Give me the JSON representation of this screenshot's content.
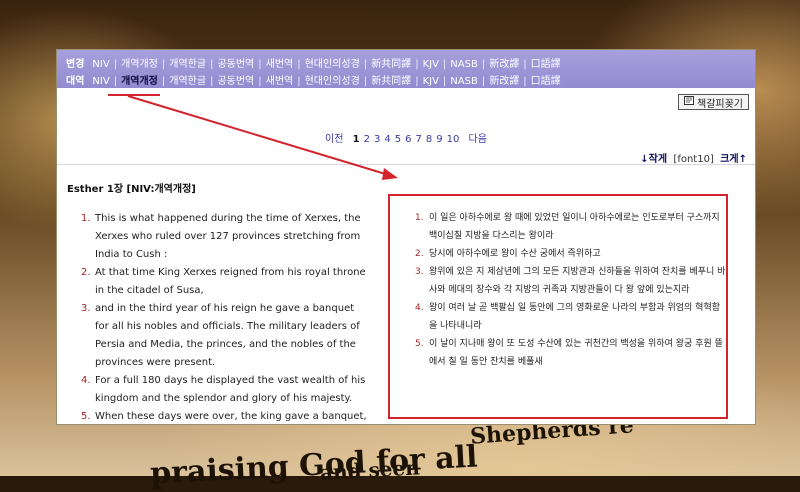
{
  "background": {
    "lines": [
      "praising God for all",
      "Shepherds re",
      "and seen"
    ]
  },
  "menu": {
    "row1": {
      "label": "변경",
      "items": [
        "NIV",
        "개역개정",
        "개역한글",
        "공동번역",
        "새번역",
        "현대인의성경",
        "新共同譯",
        "KJV",
        "NASB",
        "新改譯",
        "口語譯"
      ],
      "active_index": -1
    },
    "row2": {
      "label": "대역",
      "items": [
        "NIV",
        "개역개정",
        "개역한글",
        "공동번역",
        "새번역",
        "현대인의성경",
        "新共同譯",
        "KJV",
        "NASB",
        "新改譯",
        "口語譯"
      ],
      "active_index": 1
    }
  },
  "toolbar": {
    "bookmark_label": "책갈피꽂기"
  },
  "pager": {
    "prev": "이전",
    "pages": [
      "1",
      "2",
      "3",
      "4",
      "5",
      "6",
      "7",
      "8",
      "9",
      "10"
    ],
    "current": "1",
    "next": "다음"
  },
  "font_control": {
    "smaller": "↓작게",
    "current": "[font10]",
    "bigger": "크게↑"
  },
  "chapter_title": "Esther 1장 [NIV:개역개정]",
  "verses_en": [
    {
      "num": "1.",
      "text": "This is what happened during the time of Xerxes, the Xerxes who ruled over 127 provinces stretching from India to Cush :"
    },
    {
      "num": "2.",
      "text": "At that time King Xerxes reigned from his royal throne in the citadel of Susa,"
    },
    {
      "num": "3.",
      "text": "and in the third year of his reign he gave a banquet for all his nobles and officials. The military leaders of Persia and Media, the princes, and the nobles of the provinces were present."
    },
    {
      "num": "4.",
      "text": "For a full 180 days he displayed the vast wealth of his kingdom and the splendor and glory of his majesty."
    },
    {
      "num": "5.",
      "text": "When these days were over, the king gave a banquet, lasting seven days, in the enclosed garden of the king's palace, for all the people from the least to the greatest, who were in the citadel of"
    }
  ],
  "verses_ko": [
    {
      "num": "1.",
      "text": "이 일은 아하수에로 왕 때에 있었던 일이니 아하수에로는 인도로부터 구스까지 백이십칠 지방을 다스리는 왕이라"
    },
    {
      "num": "2.",
      "text": "당시에 아하수에로 왕이 수산 궁에서 즉위하고"
    },
    {
      "num": "3.",
      "text": "왕위에 있은 지 제삼년에 그의 모든 지방관과 신하들을 위하여 잔치를 베푸니 바사와 메대의 장수와 각 지방의 귀족과 지방관들이 다 왕 앞에 있는지라"
    },
    {
      "num": "4.",
      "text": "왕이 여러 날 곧 백팔십 일 동안에 그의 영화로운 나라의 부함과 위엄의 혁혁함을 나타내니라"
    },
    {
      "num": "5.",
      "text": "이 날이 지나매 왕이 또 도성 수산에 있는 귀천간의 백성을 위하여 왕궁 후원 뜰에서 칠 일 동안 잔치를 베풀새"
    }
  ],
  "colors": {
    "menubar": "#9b94d6",
    "accent_red": "#d3242d",
    "link_blue": "#2a2ab0",
    "verse_num": "#a42727"
  }
}
